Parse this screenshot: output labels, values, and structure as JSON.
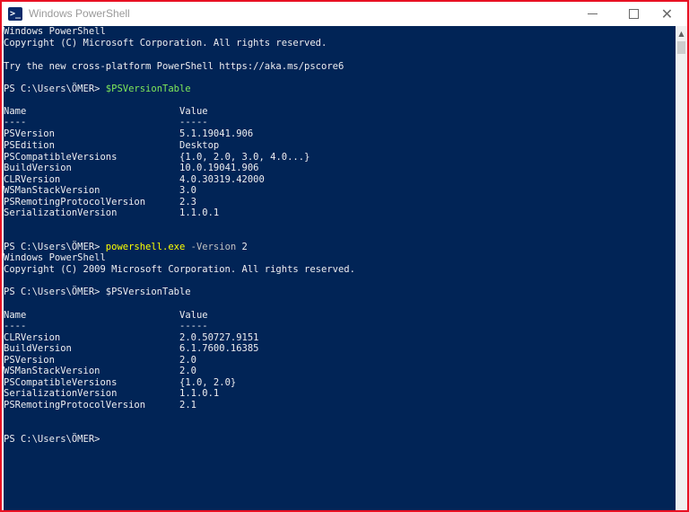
{
  "window": {
    "title": "Windows PowerShell",
    "icon": "powershell-icon",
    "icon_glyph": ">_",
    "minimize_icon": "minimize-icon",
    "maximize_icon": "maximize-icon",
    "close_glyph": "✕"
  },
  "console": {
    "colors": {
      "background": "#012456",
      "text": "#eeedf0",
      "command": "#ffff00",
      "parameter": "#c0c0c0",
      "variable": "#7fe85a",
      "border": "#e81123"
    },
    "header": [
      "Windows PowerShell",
      "Copyright (C) Microsoft Corporation. All rights reserved.",
      "",
      "Try the new cross-platform PowerShell https://aka.ms/pscore6"
    ],
    "prompt1": "PS C:\\Users\\ÖMER> ",
    "cmd1": "$PSVersionTable",
    "table1": {
      "header": [
        "Name",
        "Value"
      ],
      "separator": [
        "----",
        "-----"
      ],
      "rows": [
        [
          "PSVersion",
          "5.1.19041.906"
        ],
        [
          "PSEdition",
          "Desktop"
        ],
        [
          "PSCompatibleVersions",
          "{1.0, 2.0, 3.0, 4.0...}"
        ],
        [
          "BuildVersion",
          "10.0.19041.906"
        ],
        [
          "CLRVersion",
          "4.0.30319.42000"
        ],
        [
          "WSManStackVersion",
          "3.0"
        ],
        [
          "PSRemotingProtocolVersion",
          "2.3"
        ],
        [
          "SerializationVersion",
          "1.1.0.1"
        ]
      ]
    },
    "prompt2": "PS C:\\Users\\ÖMER> ",
    "cmd2_exe": "powershell.exe",
    "cmd2_param": " -Version",
    "cmd2_value": " 2",
    "header2": [
      "Windows PowerShell",
      "Copyright (C) 2009 Microsoft Corporation. All rights reserved."
    ],
    "prompt3": "PS C:\\Users\\ÖMER> $PSVersionTable",
    "table2": {
      "header": [
        "Name",
        "Value"
      ],
      "separator": [
        "----",
        "-----"
      ],
      "rows": [
        [
          "CLRVersion",
          "2.0.50727.9151"
        ],
        [
          "BuildVersion",
          "6.1.7600.16385"
        ],
        [
          "PSVersion",
          "2.0"
        ],
        [
          "WSManStackVersion",
          "2.0"
        ],
        [
          "PSCompatibleVersions",
          "{1.0, 2.0}"
        ],
        [
          "SerializationVersion",
          "1.1.0.1"
        ],
        [
          "PSRemotingProtocolVersion",
          "2.1"
        ]
      ]
    },
    "prompt4": "PS C:\\Users\\ÖMER>"
  },
  "scrollbar": {
    "up_arrow_glyph": "▲"
  }
}
